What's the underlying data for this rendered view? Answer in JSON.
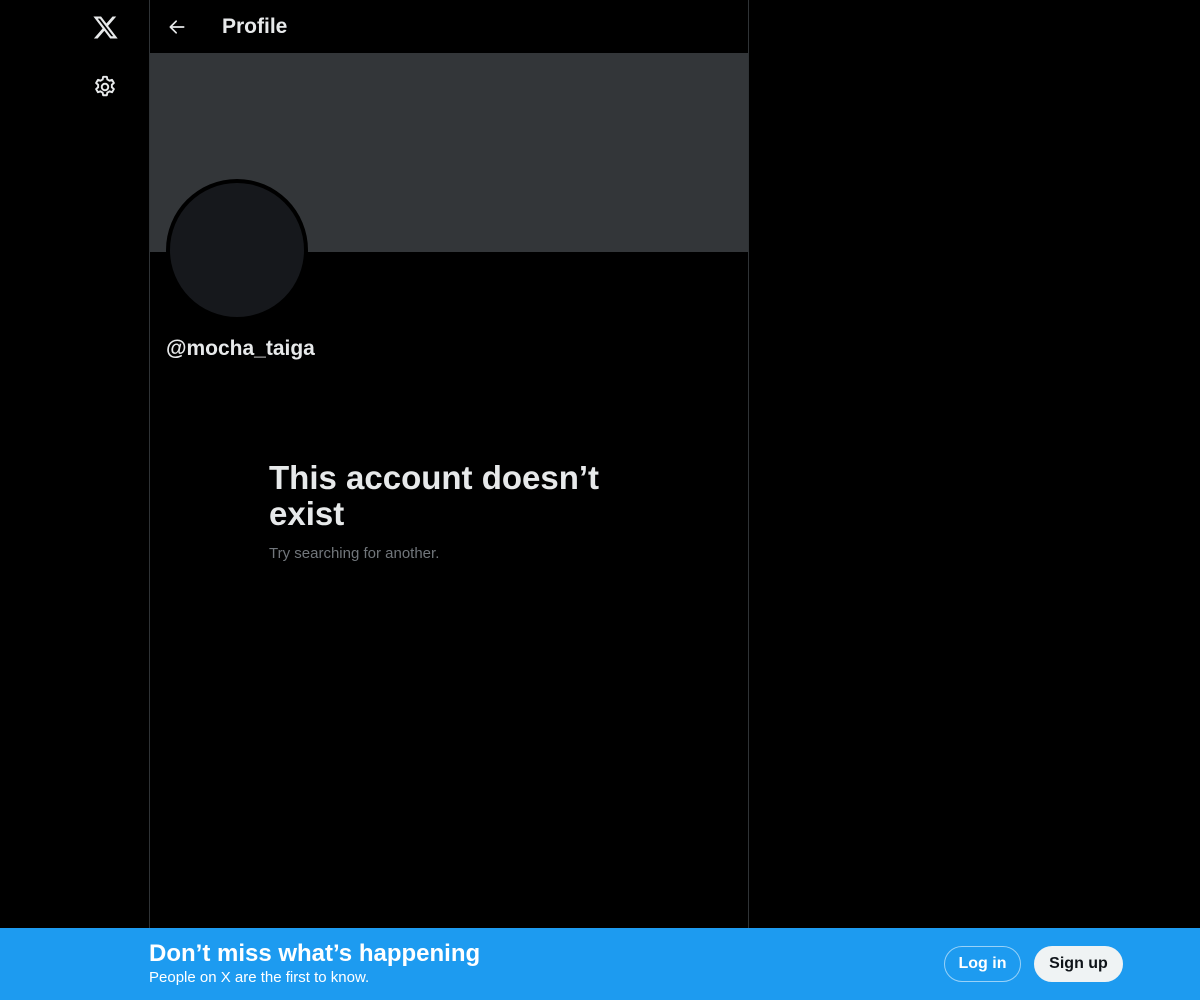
{
  "nav": {
    "logo_icon": "x-logo-icon",
    "settings_icon": "gear-icon"
  },
  "header": {
    "back_icon": "arrow-left-icon",
    "title": "Profile"
  },
  "profile": {
    "handle": "@mocha_taiga"
  },
  "empty_state": {
    "title": "This account doesn’t exist",
    "subtitle": "Try searching for another."
  },
  "bottom_bar": {
    "title": "Don’t miss what’s happening",
    "subtitle": "People on X are the first to know.",
    "login_label": "Log in",
    "signup_label": "Sign up"
  },
  "colors": {
    "background": "#000000",
    "banner": "#333639",
    "accent": "#1d9bf0",
    "secondary_text": "#71767b"
  }
}
